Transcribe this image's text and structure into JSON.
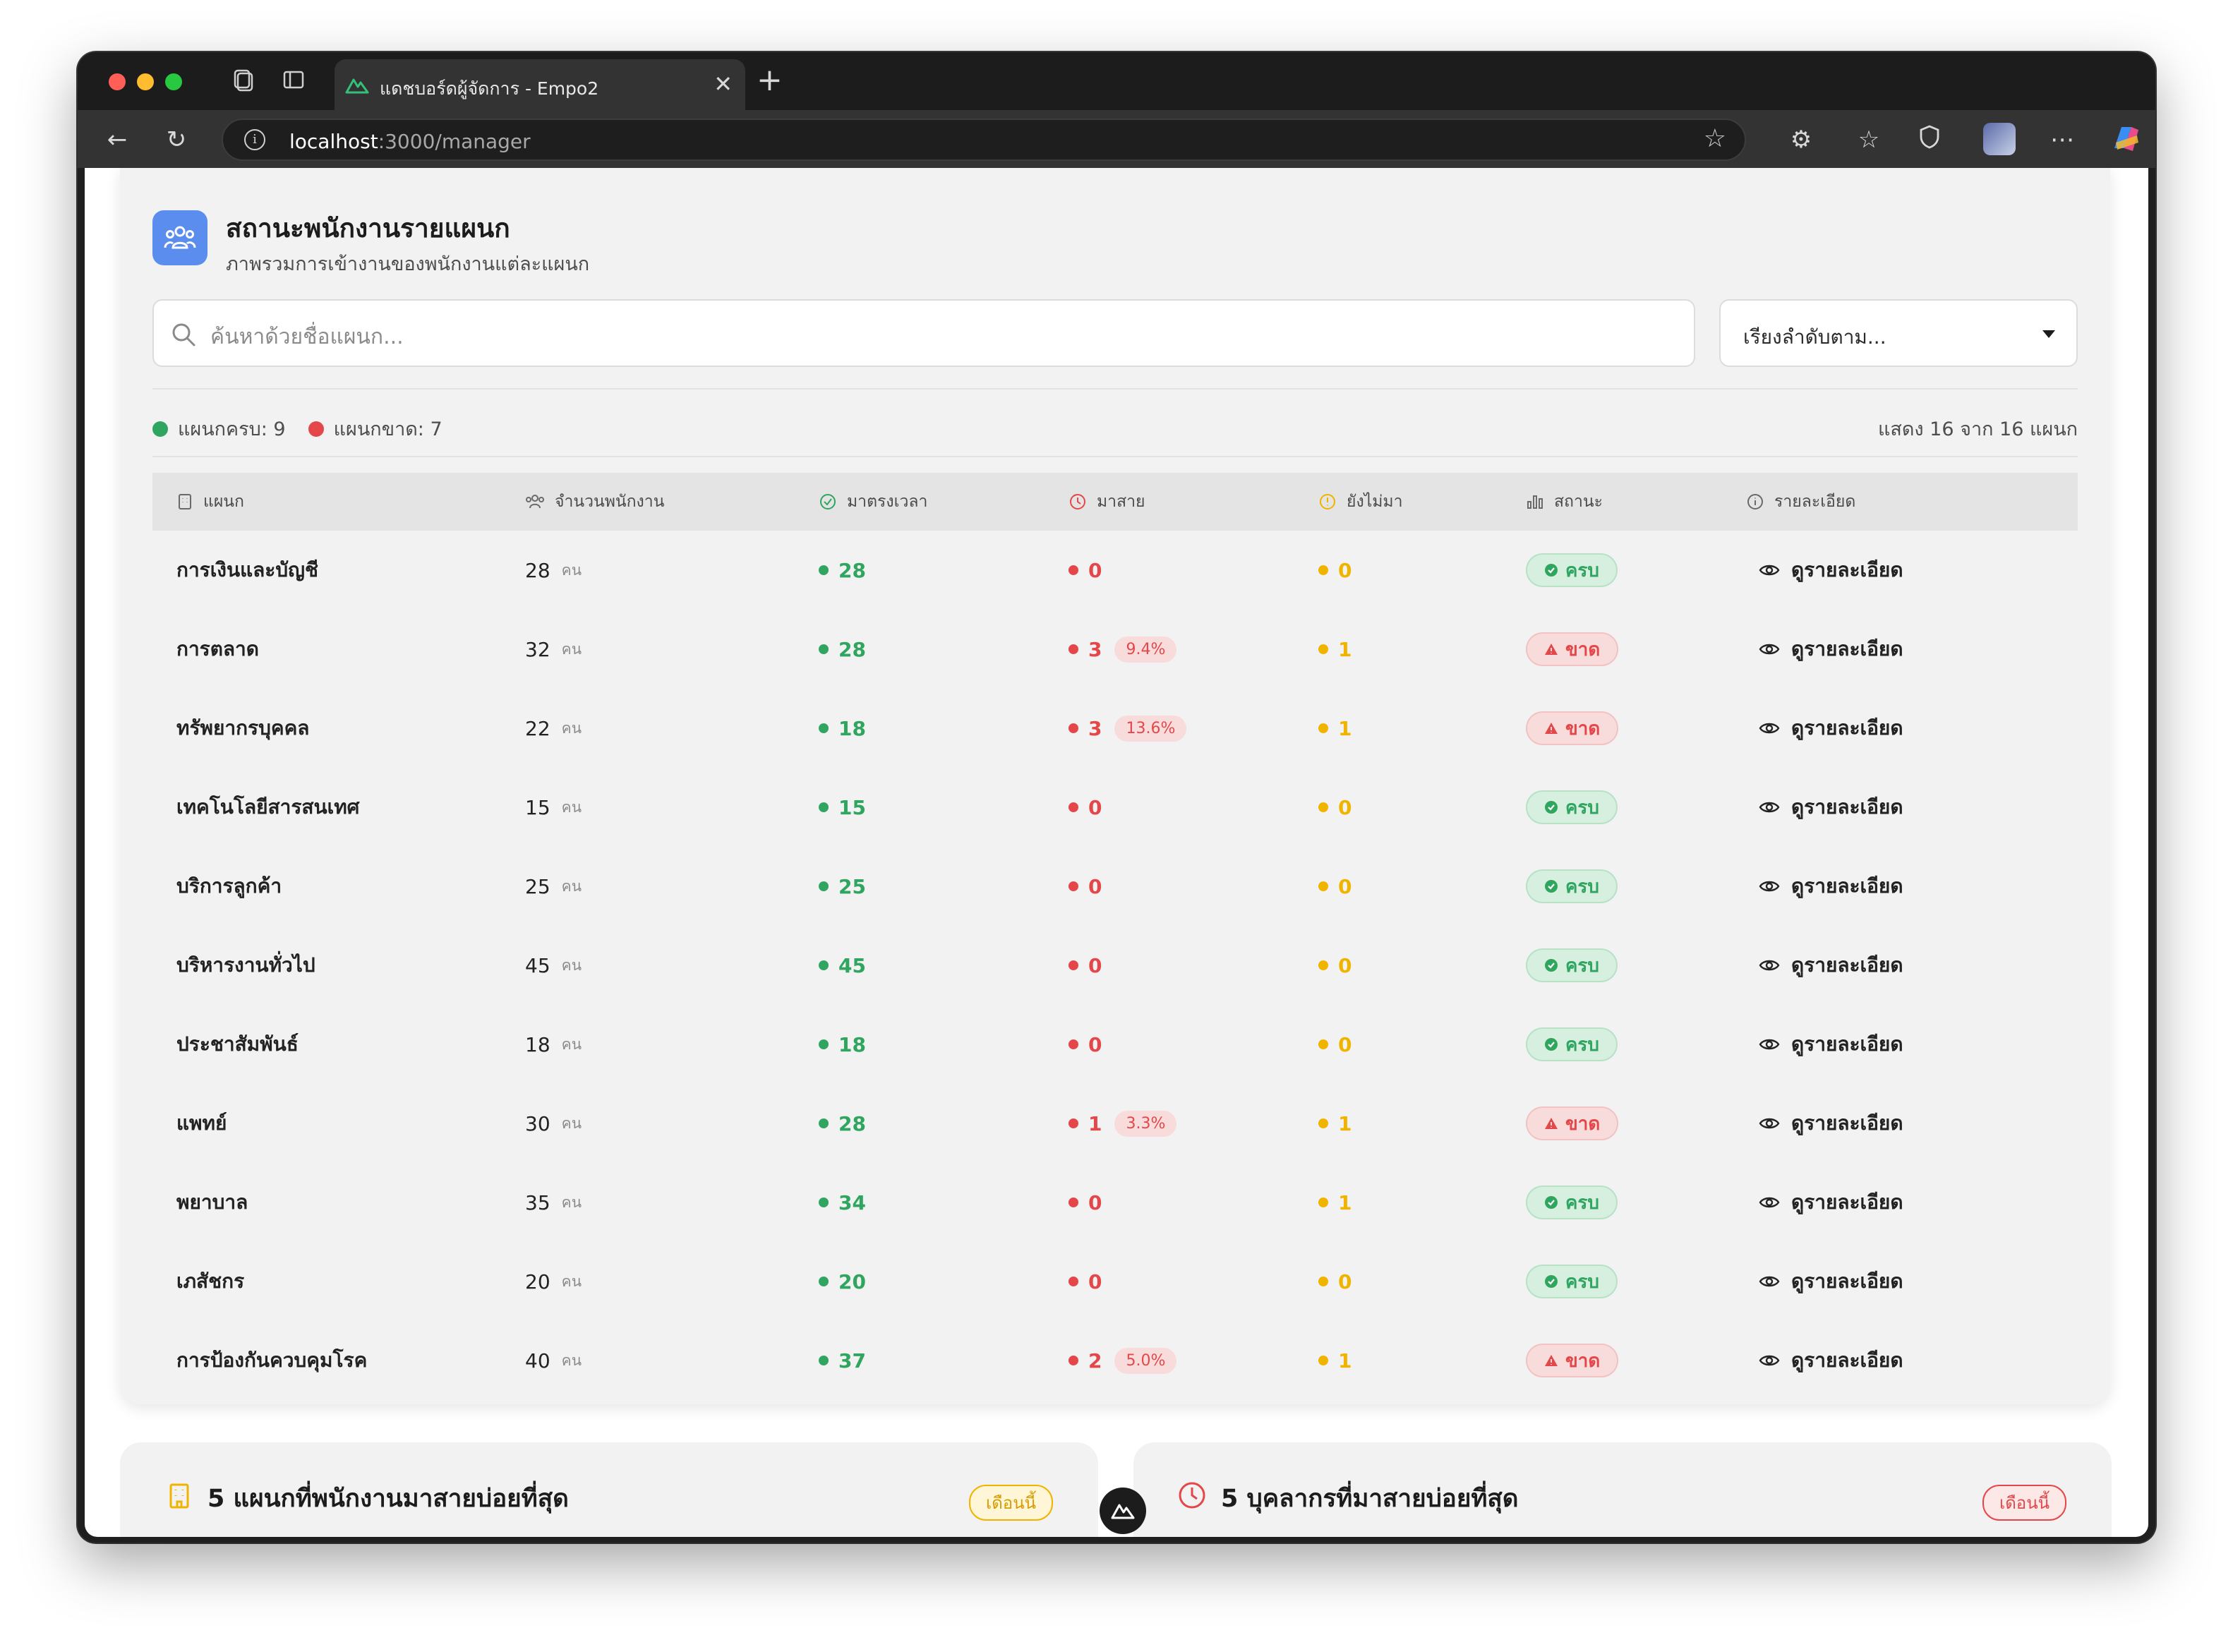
{
  "browser": {
    "tab_title": "แดชบอร์ดผู้จัดการ - Empo2",
    "url_host": "localhost",
    "url_path": ":3000/manager"
  },
  "header": {
    "title": "สถานะพนักงานรายแผนก",
    "subtitle": "ภาพรวมการเข้างานของพนักงานแต่ละแผนก"
  },
  "search": {
    "placeholder": "ค้นหาด้วยชื่อแผนก..."
  },
  "sort": {
    "label": "เรียงลำดับตาม..."
  },
  "summary": {
    "complete_label": "แผนกครบ: 9",
    "incomplete_label": "แผนกขาด: 7",
    "showing": "แสดง 16 จาก 16 แผนก"
  },
  "table": {
    "headers": {
      "department": "แผนก",
      "employees": "จำนวนพนักงาน",
      "on_time": "มาตรงเวลา",
      "late": "มาสาย",
      "not_arrived": "ยังไม่มา",
      "status": "สถานะ",
      "details": "รายละเอียด"
    },
    "unit": "คน",
    "status_ok": "ครบ",
    "status_bad": "ขาด",
    "view_label": "ดูรายละเอียด",
    "rows": [
      {
        "department": "การเงินและบัญชี",
        "total": "28",
        "on_time": "28",
        "late": "0",
        "late_pct": "",
        "not_arrived": "0",
        "status": "ok"
      },
      {
        "department": "การตลาด",
        "total": "32",
        "on_time": "28",
        "late": "3",
        "late_pct": "9.4%",
        "not_arrived": "1",
        "status": "bad"
      },
      {
        "department": "ทรัพยากรบุคคล",
        "total": "22",
        "on_time": "18",
        "late": "3",
        "late_pct": "13.6%",
        "not_arrived": "1",
        "status": "bad"
      },
      {
        "department": "เทคโนโลยีสารสนเทศ",
        "total": "15",
        "on_time": "15",
        "late": "0",
        "late_pct": "",
        "not_arrived": "0",
        "status": "ok"
      },
      {
        "department": "บริการลูกค้า",
        "total": "25",
        "on_time": "25",
        "late": "0",
        "late_pct": "",
        "not_arrived": "0",
        "status": "ok"
      },
      {
        "department": "บริหารงานทั่วไป",
        "total": "45",
        "on_time": "45",
        "late": "0",
        "late_pct": "",
        "not_arrived": "0",
        "status": "ok"
      },
      {
        "department": "ประชาสัมพันธ์",
        "total": "18",
        "on_time": "18",
        "late": "0",
        "late_pct": "",
        "not_arrived": "0",
        "status": "ok"
      },
      {
        "department": "แพทย์",
        "total": "30",
        "on_time": "28",
        "late": "1",
        "late_pct": "3.3%",
        "not_arrived": "1",
        "status": "bad"
      },
      {
        "department": "พยาบาล",
        "total": "35",
        "on_time": "34",
        "late": "0",
        "late_pct": "",
        "not_arrived": "1",
        "status": "ok"
      },
      {
        "department": "เภสัชกร",
        "total": "20",
        "on_time": "20",
        "late": "0",
        "late_pct": "",
        "not_arrived": "0",
        "status": "ok"
      },
      {
        "department": "การป้องกันควบคุมโรค",
        "total": "40",
        "on_time": "37",
        "late": "2",
        "late_pct": "5.0%",
        "not_arrived": "1",
        "status": "bad"
      }
    ]
  },
  "bottom_cards": [
    {
      "title": "5 แผนกที่พนักงานมาสายบ่อยที่สุด",
      "pill": "เดือนนี้"
    },
    {
      "title": "5 บุคลากรที่มาสายบ่อยที่สุด",
      "pill": "เดือนนี้"
    }
  ],
  "colors": {
    "accent_blue": "#5b8def",
    "green": "#2fa55f",
    "red": "#e4474a",
    "yellow": "#f0b400"
  }
}
